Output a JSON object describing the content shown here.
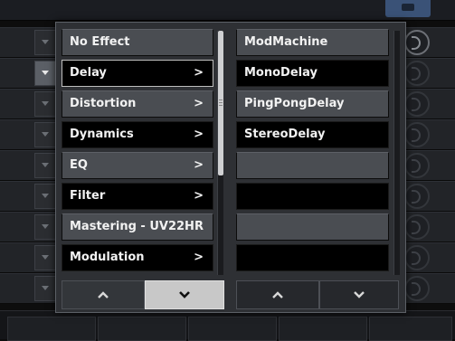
{
  "effects_menu": {
    "categories": [
      {
        "label": "No Effect",
        "chevron": ""
      },
      {
        "label": "Delay",
        "chevron": ">"
      },
      {
        "label": "Distortion",
        "chevron": ">"
      },
      {
        "label": "Dynamics",
        "chevron": ">"
      },
      {
        "label": "EQ",
        "chevron": ">"
      },
      {
        "label": "Filter",
        "chevron": ">"
      },
      {
        "label": "Mastering - UV22HR",
        "chevron": ""
      },
      {
        "label": "Modulation",
        "chevron": ">"
      }
    ],
    "selected_category": "Delay",
    "plugins": [
      {
        "label": "ModMachine"
      },
      {
        "label": "MonoDelay"
      },
      {
        "label": "PingPongDelay"
      },
      {
        "label": "StereoDelay"
      },
      {
        "label": ""
      },
      {
        "label": ""
      },
      {
        "label": ""
      },
      {
        "label": ""
      }
    ]
  },
  "icons": {
    "page_up": "chevron-up-icon",
    "page_down": "chevron-down-icon",
    "slot_dropdown": "triangle-down-icon",
    "knob": "knob-icon"
  },
  "colors": {
    "menu_gray": "#4a4d52",
    "menu_black": "#000000",
    "selected_border": "#bfbfbf",
    "text": "#f2f2f2",
    "header_tab": "#3a5277"
  }
}
